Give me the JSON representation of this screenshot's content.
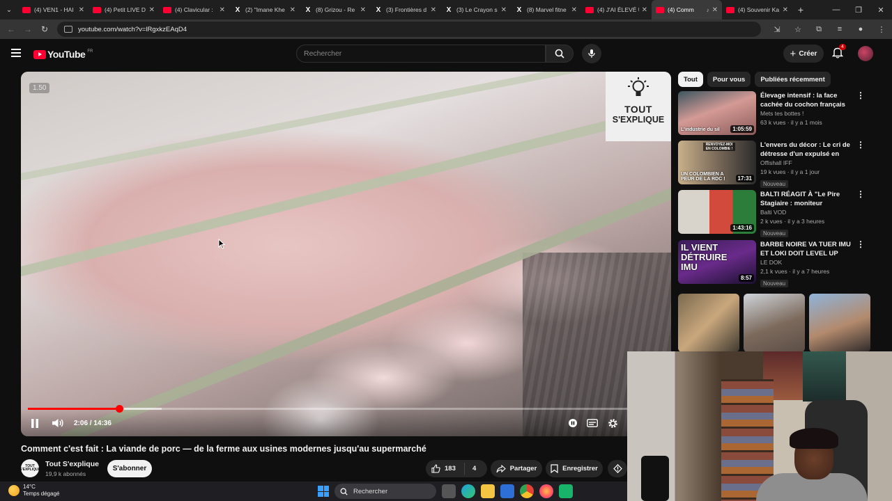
{
  "browser": {
    "tabs": [
      {
        "label": "(4) VEN1 - HAI",
        "icon": "youtube-icon"
      },
      {
        "label": "(4) Petit LIVE D",
        "icon": "youtube-icon"
      },
      {
        "label": "(4) Clavicular :",
        "icon": "youtube-icon"
      },
      {
        "label": "(2) \"Imane Khe",
        "icon": "x-icon"
      },
      {
        "label": "(8) Grizou - Re",
        "icon": "x-icon"
      },
      {
        "label": "(3) Frontières d",
        "icon": "x-icon"
      },
      {
        "label": "(3) Le Crayon s",
        "icon": "x-icon"
      },
      {
        "label": "(8) Marvel fitne",
        "icon": "x-icon"
      },
      {
        "label": "(4) J'AI ÉLEVÉ U",
        "icon": "youtube-icon"
      },
      {
        "label": "(4) Comm",
        "icon": "youtube-icon",
        "active": true
      },
      {
        "label": "(4) Souvenir Ka",
        "icon": "youtube-icon"
      }
    ],
    "url": "youtube.com/watch?v=lRgxkzEAqD4"
  },
  "header": {
    "logo_text": "YouTube",
    "country": "FR",
    "search_placeholder": "Rechercher",
    "create_label": "Créer",
    "notif_count": "4"
  },
  "player": {
    "speed": "1.50",
    "time": "2:06 / 14:36",
    "played_fraction": 0.144,
    "buffered_fraction": 0.21,
    "logo_line1": "TOUT",
    "logo_line2": "S'EXPLIQUE"
  },
  "video": {
    "title": "Comment c'est fait : La viande de porc — de la ferme aux usines modernes jusqu'au supermarché",
    "channel_avatar_text": "TOUT S'EXPLIQUE",
    "channel": "Tout S'explique",
    "subscribers": "19,9 k abonnés",
    "subscribe_label": "S'abonner",
    "likes": "183",
    "dislikes": "4",
    "share_label": "Partager",
    "save_label": "Enregistrer"
  },
  "chips": [
    "Tout",
    "Pour vous",
    "Publiées récemment"
  ],
  "recommendations": [
    {
      "title": "Élevage intensif : la face cachée du cochon français",
      "channel": "Mets tes bottes !",
      "meta": "63 k vues · il y a 1 mois",
      "duration": "1:05:59",
      "thumb_caption": "L'industrie du sil",
      "new": ""
    },
    {
      "title": "L'envers du décor : Le cri de détresse d'un expulsé en RDC",
      "channel": "Offishall IFF",
      "meta": "19 k vues · il y a 1 jour",
      "duration": "17:31",
      "thumb_caption": "UN COLOMBIEN A PEUR DE LA RDC !",
      "thumb_top": "RENVOYEZ-MOI EN COLOMBIE !",
      "new": "Nouveau"
    },
    {
      "title": "BALTI RÉAGIT À \"Le Pire Stagiaire : moniteur d'auto-…",
      "channel": "Balti VOD",
      "meta": "2 k vues · il y a 3 heures",
      "duration": "1:43:16",
      "thumb_caption": "",
      "new": "Nouveau"
    },
    {
      "title": "BARBE NOIRE VA TUER IMU ET LOKI DOIT LEVEL UP POUR …",
      "channel": "LE DOK",
      "meta": "2,1 k vues · il y a 7 heures",
      "duration": "8:57",
      "thumb_caption": "IL VIENT DÉTRUIRE IMU",
      "new": "Nouveau"
    }
  ],
  "taskbar": {
    "temp": "14°C",
    "weather": "Temps dégagé",
    "search_label": "Rechercher"
  },
  "colors": {
    "accent": "#ff0000",
    "bg": "#0f0f0f",
    "chip": "#272727"
  }
}
